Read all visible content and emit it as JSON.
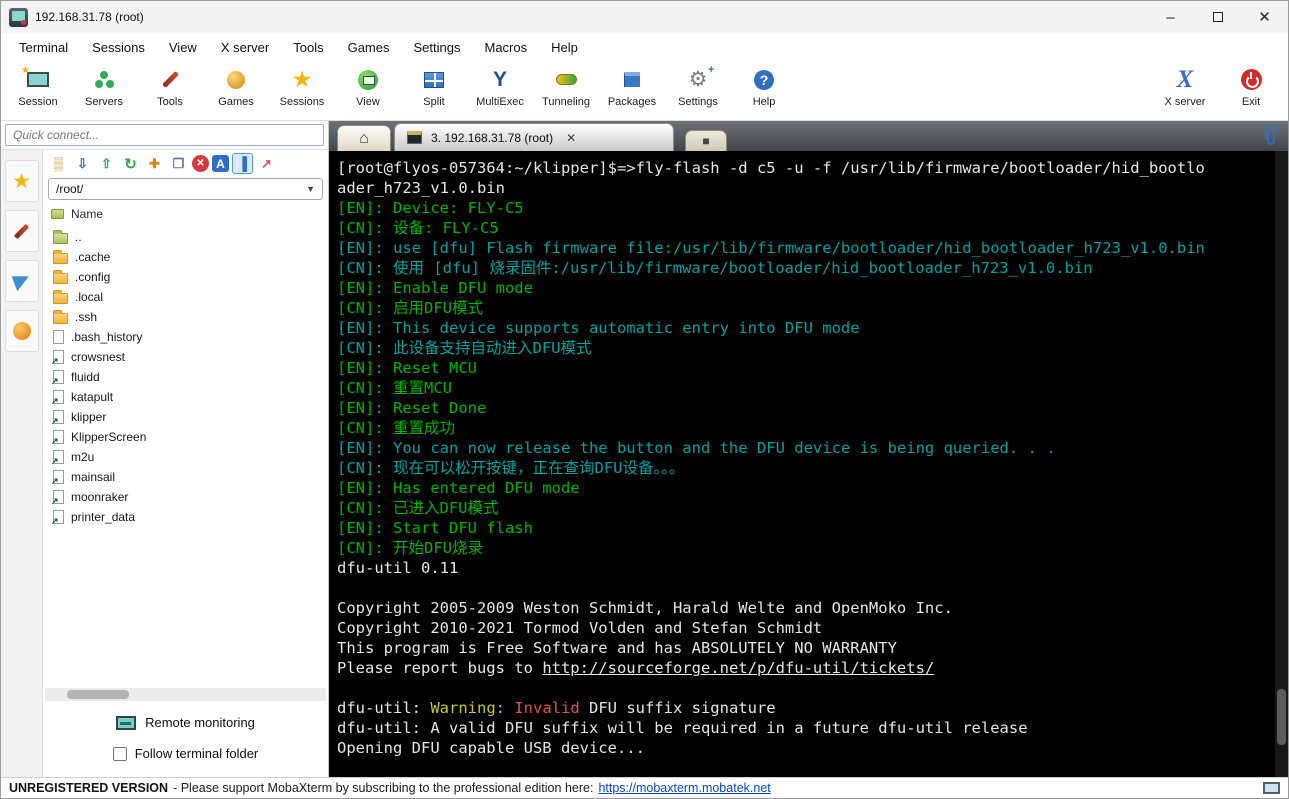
{
  "window": {
    "title": "192.168.31.78 (root)"
  },
  "menu": {
    "items": [
      "Terminal",
      "Sessions",
      "View",
      "X server",
      "Tools",
      "Games",
      "Settings",
      "Macros",
      "Help"
    ]
  },
  "toolbar": {
    "items": [
      {
        "label": "Session"
      },
      {
        "label": "Servers"
      },
      {
        "label": "Tools"
      },
      {
        "label": "Games"
      },
      {
        "label": "Sessions"
      },
      {
        "label": "View"
      },
      {
        "label": "Split"
      },
      {
        "label": "MultiExec"
      },
      {
        "label": "Tunneling"
      },
      {
        "label": "Packages"
      },
      {
        "label": "Settings"
      },
      {
        "label": "Help"
      },
      {
        "label": "X server"
      },
      {
        "label": "Exit"
      }
    ]
  },
  "sidebar": {
    "quick_connect_placeholder": "Quick connect...",
    "path": "/root/",
    "column_header": "Name",
    "files": [
      {
        "name": "..",
        "icon": "folder-up"
      },
      {
        "name": ".cache",
        "icon": "folder"
      },
      {
        "name": ".config",
        "icon": "folder"
      },
      {
        "name": ".local",
        "icon": "folder"
      },
      {
        "name": ".ssh",
        "icon": "folder"
      },
      {
        "name": ".bash_history",
        "icon": "file"
      },
      {
        "name": "crowsnest",
        "icon": "symlink"
      },
      {
        "name": "fluidd",
        "icon": "symlink"
      },
      {
        "name": "katapult",
        "icon": "symlink"
      },
      {
        "name": "klipper",
        "icon": "symlink"
      },
      {
        "name": "KlipperScreen",
        "icon": "symlink"
      },
      {
        "name": "m2u",
        "icon": "symlink"
      },
      {
        "name": "mainsail",
        "icon": "symlink"
      },
      {
        "name": "moonraker",
        "icon": "symlink"
      },
      {
        "name": "printer_data",
        "icon": "symlink"
      }
    ],
    "remote_monitoring_label": "Remote monitoring",
    "follow_terminal_label": "Follow terminal folder"
  },
  "tabs": {
    "active_label": "3. 192.168.31.78 (root)"
  },
  "terminal": {
    "palette": {
      "fg": "#e6e6e6",
      "green": "#00b400",
      "teal": "#00a2a2",
      "yellow": "#c9c929",
      "red": "#e0544a",
      "link": "#e6e6e6"
    },
    "lines": [
      [
        [
          "[root@flyos-057364:~/klipper]$=>",
          "fg"
        ],
        [
          "fly-flash -d c5 -u -f /usr/lib/firmware/bootloader/hid_bootlo",
          "fg"
        ]
      ],
      [
        [
          "ader_h723_v1.0.bin",
          "fg"
        ]
      ],
      [
        [
          "[EN]: Device: FLY-C5",
          "green"
        ]
      ],
      [
        [
          "[CN]: 设备: FLY-C5",
          "green"
        ]
      ],
      [
        [
          "[EN]: use [dfu] Flash firmware file:/usr/lib/firmware/bootloader/hid_bootloader_h723_v1.0.bin",
          "teal"
        ]
      ],
      [
        [
          "[CN]: 使用 [dfu] 烧录固件:/usr/lib/firmware/bootloader/hid_bootloader_h723_v1.0.bin",
          "teal"
        ]
      ],
      [
        [
          "[EN]: Enable DFU mode",
          "green"
        ]
      ],
      [
        [
          "[CN]: 启用DFU模式",
          "green"
        ]
      ],
      [
        [
          "[EN]: This device supports automatic entry into DFU mode",
          "teal"
        ]
      ],
      [
        [
          "[CN]: 此设备支持自动进入DFU模式",
          "teal"
        ]
      ],
      [
        [
          "[EN]: Reset MCU",
          "green"
        ]
      ],
      [
        [
          "[CN]: 重置MCU",
          "green"
        ]
      ],
      [
        [
          "[EN]: Reset Done",
          "green"
        ]
      ],
      [
        [
          "[CN]: 重置成功",
          "green"
        ]
      ],
      [
        [
          "[EN]: You can now release the button and the DFU device is being queried. . .",
          "teal"
        ]
      ],
      [
        [
          "[CN]: 现在可以松开按键，正在查询DFU设备。。。",
          "teal"
        ]
      ],
      [
        [
          "[EN]: Has entered DFU mode",
          "green"
        ]
      ],
      [
        [
          "[CN]: 已进入DFU模式",
          "green"
        ]
      ],
      [
        [
          "[EN]: Start DFU flash",
          "green"
        ]
      ],
      [
        [
          "[CN]: 开始DFU烧录",
          "green"
        ]
      ],
      [
        [
          "dfu-util 0.11",
          "fg"
        ]
      ],
      [],
      [
        [
          "Copyright 2005-2009 Weston Schmidt, Harald Welte and OpenMoko Inc.",
          "fg"
        ]
      ],
      [
        [
          "Copyright 2010-2021 Tormod Volden and Stefan Schmidt",
          "fg"
        ]
      ],
      [
        [
          "This program is Free Software and has ABSOLUTELY NO WARRANTY",
          "fg"
        ]
      ],
      [
        [
          "Please report bugs to ",
          "fg"
        ],
        [
          "http://sourceforge.net/p/dfu-util/tickets/",
          "link"
        ]
      ],
      [],
      [
        [
          "dfu-util: ",
          "fg"
        ],
        [
          "Warning:",
          "yellow"
        ],
        [
          " ",
          "fg"
        ],
        [
          "Invalid",
          "red"
        ],
        [
          " DFU suffix signature",
          "fg"
        ]
      ],
      [
        [
          "dfu-util: A valid DFU suffix will be required in a future dfu-util release",
          "fg"
        ]
      ],
      [
        [
          "Opening DFU capable USB device...",
          "fg"
        ]
      ]
    ]
  },
  "statusbar": {
    "unregistered": "UNREGISTERED VERSION",
    "message": "-  Please support MobaXterm by subscribing to the professional edition here:",
    "link": "https://mobaxterm.mobatek.net"
  }
}
